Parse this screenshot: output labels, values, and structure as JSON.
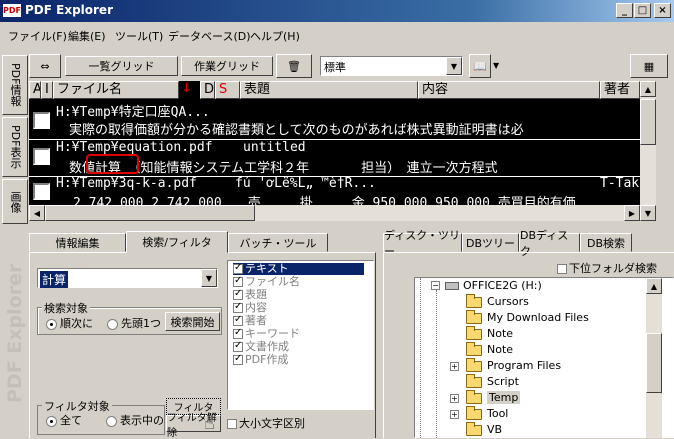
{
  "window": {
    "title": "PDF Explorer",
    "app_icon": "PDF"
  },
  "menu": [
    "ファイル(F)",
    "編集(E)",
    "ツール(T)",
    "データベース(D)",
    "ヘルプ(H)"
  ],
  "toolbar": {
    "grid_list_label": "一覧グリッド",
    "work_grid_label": "作業グリッド",
    "style_select": "標準"
  },
  "side_tabs": {
    "pdf_info": "PDF情報",
    "pdf_display": "PDF表示",
    "image": "画像",
    "watermark": "PDF Explorer"
  },
  "grid": {
    "columns": [
      "A",
      "I",
      "ファイル名",
      "↓",
      "D",
      "S",
      "表題",
      "内容",
      "著者"
    ],
    "rows": [
      {
        "path": "H:¥Temp¥特定口座QA...",
        "detail": "　実際の取得価額が分かる確認書類として次のものがあれば株式異動証明書は必"
      },
      {
        "path": "H:¥Temp¥equation.pdf",
        "title": "untitled",
        "detail": "数値計算　（知能情報システム工学科２年　　　　担当）　連立一次方程式"
      },
      {
        "path": "H:¥Temp¥3q-k-a.pdf",
        "title": "fú 'ơLë%L„ ™è†R...",
        "author": "T-Tak",
        "detail": "2,742,000 2,742,000　　売　　　掛　　　金 950,000 950,000 売買目的有価"
      }
    ]
  },
  "left_tabs": [
    "情報編集",
    "検索/フィルタ",
    "バッチ・ツール"
  ],
  "search": {
    "query": "計算",
    "search_target_label": "検索対象",
    "radio_sequential": "順次に",
    "radio_first": "先頭1つ",
    "search_start_button": "検索開始",
    "filter_target_label": "フィルタ対象",
    "radio_all": "全て",
    "radio_displayed": "表示中の",
    "filter_button": "フィルタ",
    "filter_release_button": "フィルタ解除",
    "case_sensitive_label": "大小文字区別"
  },
  "fields": [
    "テキスト",
    "ファイル名",
    "表題",
    "内容",
    "著者",
    "キーワード",
    "文書作成",
    "PDF作成"
  ],
  "right_tabs": [
    "ディスク・ツリー",
    "DBツリー",
    "DBディスク",
    "DB検索"
  ],
  "subfolder_search_label": "下位フォルダ検索",
  "tree": {
    "drive": "OFFICE2G (H:)",
    "folders": [
      "Cursors",
      "My Download Files",
      "Note",
      "Note",
      "Program Files",
      "Script",
      "Temp",
      "Tool",
      "VB"
    ]
  },
  "colors": {
    "accent_red": "#e00000",
    "grid_bg": "#000000",
    "selection": "#0a246a"
  }
}
